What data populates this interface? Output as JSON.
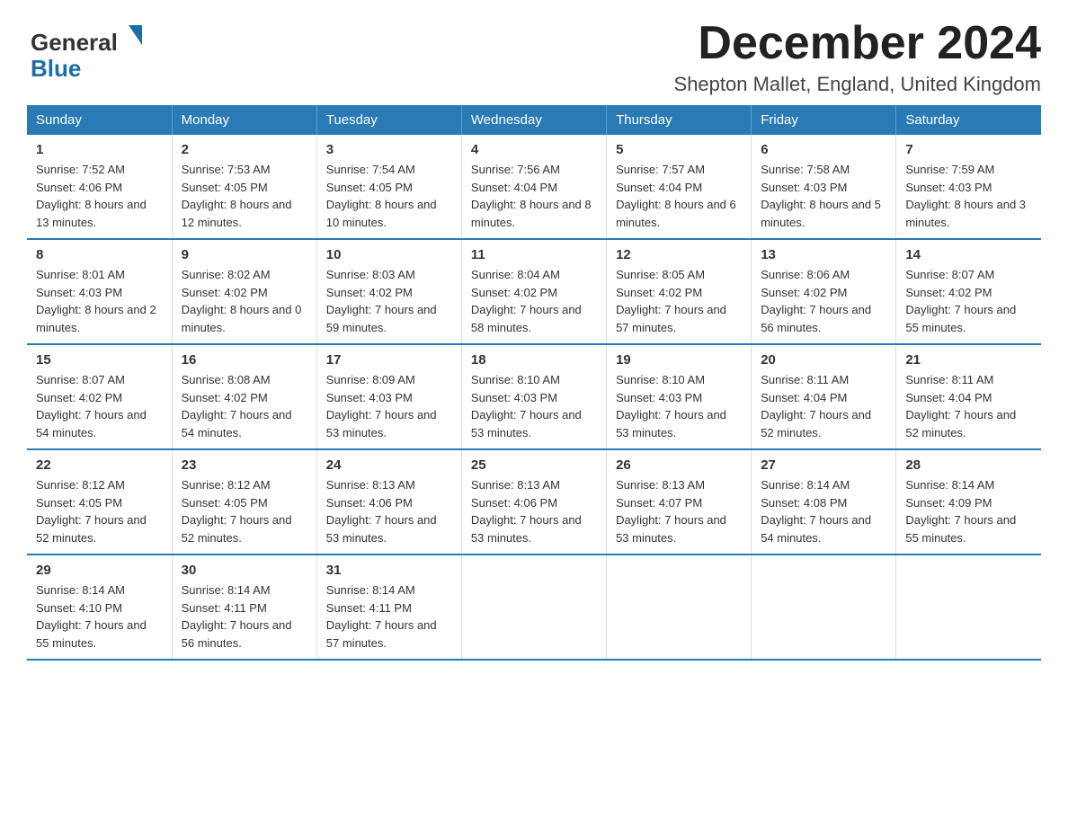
{
  "logo": {
    "text_general": "General",
    "text_blue": "Blue"
  },
  "title": {
    "month_year": "December 2024",
    "location": "Shepton Mallet, England, United Kingdom"
  },
  "weekdays": [
    "Sunday",
    "Monday",
    "Tuesday",
    "Wednesday",
    "Thursday",
    "Friday",
    "Saturday"
  ],
  "weeks": [
    [
      {
        "day": "1",
        "sunrise": "7:52 AM",
        "sunset": "4:06 PM",
        "daylight": "8 hours and 13 minutes."
      },
      {
        "day": "2",
        "sunrise": "7:53 AM",
        "sunset": "4:05 PM",
        "daylight": "8 hours and 12 minutes."
      },
      {
        "day": "3",
        "sunrise": "7:54 AM",
        "sunset": "4:05 PM",
        "daylight": "8 hours and 10 minutes."
      },
      {
        "day": "4",
        "sunrise": "7:56 AM",
        "sunset": "4:04 PM",
        "daylight": "8 hours and 8 minutes."
      },
      {
        "day": "5",
        "sunrise": "7:57 AM",
        "sunset": "4:04 PM",
        "daylight": "8 hours and 6 minutes."
      },
      {
        "day": "6",
        "sunrise": "7:58 AM",
        "sunset": "4:03 PM",
        "daylight": "8 hours and 5 minutes."
      },
      {
        "day": "7",
        "sunrise": "7:59 AM",
        "sunset": "4:03 PM",
        "daylight": "8 hours and 3 minutes."
      }
    ],
    [
      {
        "day": "8",
        "sunrise": "8:01 AM",
        "sunset": "4:03 PM",
        "daylight": "8 hours and 2 minutes."
      },
      {
        "day": "9",
        "sunrise": "8:02 AM",
        "sunset": "4:02 PM",
        "daylight": "8 hours and 0 minutes."
      },
      {
        "day": "10",
        "sunrise": "8:03 AM",
        "sunset": "4:02 PM",
        "daylight": "7 hours and 59 minutes."
      },
      {
        "day": "11",
        "sunrise": "8:04 AM",
        "sunset": "4:02 PM",
        "daylight": "7 hours and 58 minutes."
      },
      {
        "day": "12",
        "sunrise": "8:05 AM",
        "sunset": "4:02 PM",
        "daylight": "7 hours and 57 minutes."
      },
      {
        "day": "13",
        "sunrise": "8:06 AM",
        "sunset": "4:02 PM",
        "daylight": "7 hours and 56 minutes."
      },
      {
        "day": "14",
        "sunrise": "8:07 AM",
        "sunset": "4:02 PM",
        "daylight": "7 hours and 55 minutes."
      }
    ],
    [
      {
        "day": "15",
        "sunrise": "8:07 AM",
        "sunset": "4:02 PM",
        "daylight": "7 hours and 54 minutes."
      },
      {
        "day": "16",
        "sunrise": "8:08 AM",
        "sunset": "4:02 PM",
        "daylight": "7 hours and 54 minutes."
      },
      {
        "day": "17",
        "sunrise": "8:09 AM",
        "sunset": "4:03 PM",
        "daylight": "7 hours and 53 minutes."
      },
      {
        "day": "18",
        "sunrise": "8:10 AM",
        "sunset": "4:03 PM",
        "daylight": "7 hours and 53 minutes."
      },
      {
        "day": "19",
        "sunrise": "8:10 AM",
        "sunset": "4:03 PM",
        "daylight": "7 hours and 53 minutes."
      },
      {
        "day": "20",
        "sunrise": "8:11 AM",
        "sunset": "4:04 PM",
        "daylight": "7 hours and 52 minutes."
      },
      {
        "day": "21",
        "sunrise": "8:11 AM",
        "sunset": "4:04 PM",
        "daylight": "7 hours and 52 minutes."
      }
    ],
    [
      {
        "day": "22",
        "sunrise": "8:12 AM",
        "sunset": "4:05 PM",
        "daylight": "7 hours and 52 minutes."
      },
      {
        "day": "23",
        "sunrise": "8:12 AM",
        "sunset": "4:05 PM",
        "daylight": "7 hours and 52 minutes."
      },
      {
        "day": "24",
        "sunrise": "8:13 AM",
        "sunset": "4:06 PM",
        "daylight": "7 hours and 53 minutes."
      },
      {
        "day": "25",
        "sunrise": "8:13 AM",
        "sunset": "4:06 PM",
        "daylight": "7 hours and 53 minutes."
      },
      {
        "day": "26",
        "sunrise": "8:13 AM",
        "sunset": "4:07 PM",
        "daylight": "7 hours and 53 minutes."
      },
      {
        "day": "27",
        "sunrise": "8:14 AM",
        "sunset": "4:08 PM",
        "daylight": "7 hours and 54 minutes."
      },
      {
        "day": "28",
        "sunrise": "8:14 AM",
        "sunset": "4:09 PM",
        "daylight": "7 hours and 55 minutes."
      }
    ],
    [
      {
        "day": "29",
        "sunrise": "8:14 AM",
        "sunset": "4:10 PM",
        "daylight": "7 hours and 55 minutes."
      },
      {
        "day": "30",
        "sunrise": "8:14 AM",
        "sunset": "4:11 PM",
        "daylight": "7 hours and 56 minutes."
      },
      {
        "day": "31",
        "sunrise": "8:14 AM",
        "sunset": "4:11 PM",
        "daylight": "7 hours and 57 minutes."
      },
      null,
      null,
      null,
      null
    ]
  ],
  "labels": {
    "sunrise": "Sunrise:",
    "sunset": "Sunset:",
    "daylight": "Daylight:"
  }
}
